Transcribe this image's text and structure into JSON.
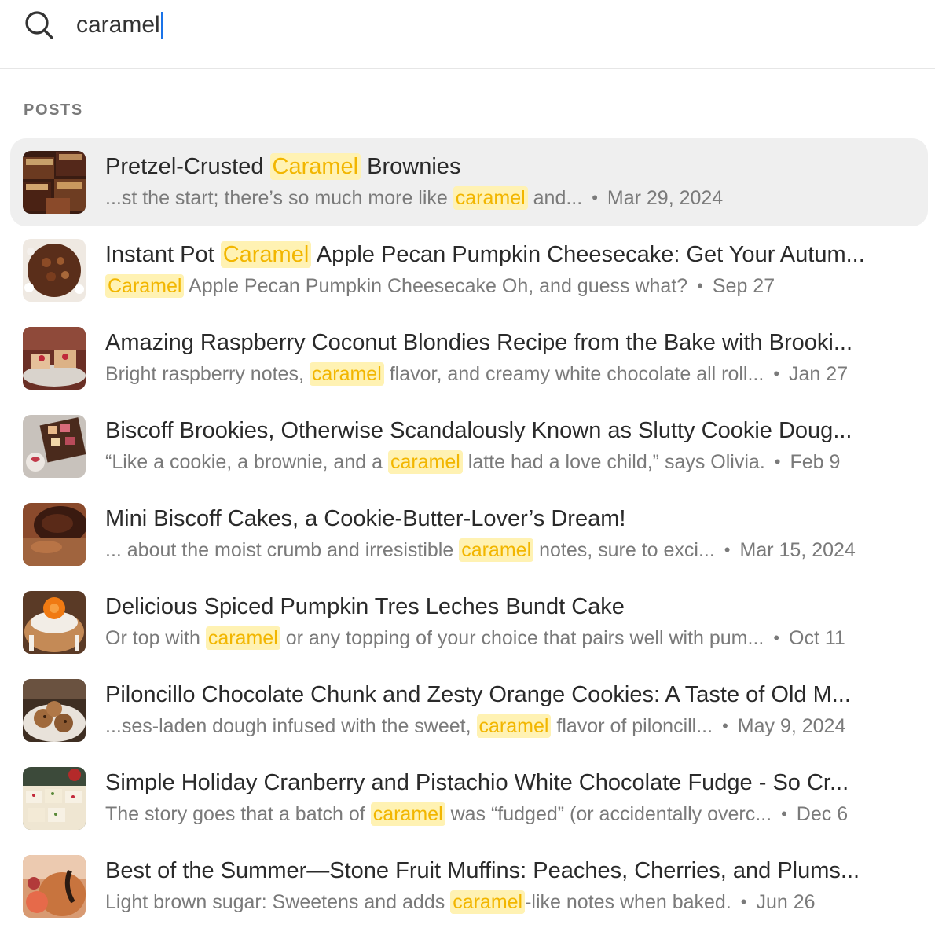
{
  "search": {
    "value": "caramel"
  },
  "section": {
    "label": "POSTS"
  },
  "colors": {
    "highlight_bg": "#fff2b3",
    "highlight_fg": "#f2b600",
    "selected_row": "#efefef",
    "caret": "#1a73e8"
  },
  "results": [
    {
      "title_pre": "Pretzel-Crusted ",
      "title_hl": "Caramel",
      "title_post": " Brownies",
      "snip_pre": "...st the start; there’s so much more like ",
      "snip_hl": "caramel",
      "snip_post": " and...",
      "date": "Mar 29, 2024"
    },
    {
      "title_pre": "Instant Pot ",
      "title_hl": "Caramel",
      "title_post": " Apple Pecan Pumpkin Cheesecake: Get Your Autum...",
      "snip_pre": "",
      "snip_hl": "Caramel",
      "snip_post": " Apple Pecan Pumpkin Cheesecake Oh, and guess what?",
      "date": "Sep 27"
    },
    {
      "title_pre": "Amazing Raspberry Coconut Blondies Recipe from the Bake with Brooki...",
      "title_hl": "",
      "title_post": "",
      "snip_pre": "Bright raspberry notes, ",
      "snip_hl": "caramel",
      "snip_post": " flavor, and creamy white chocolate all roll...",
      "date": "Jan 27"
    },
    {
      "title_pre": "Biscoff Brookies, Otherwise Scandalously Known as Slutty Cookie Doug...",
      "title_hl": "",
      "title_post": "",
      "snip_pre": "“Like a cookie, a brownie, and a ",
      "snip_hl": "caramel",
      "snip_post": " latte had a love child,” says Olivia.",
      "date": "Feb 9"
    },
    {
      "title_pre": "Mini Biscoff Cakes, a Cookie-Butter-Lover’s Dream!",
      "title_hl": "",
      "title_post": "",
      "snip_pre": "... about the moist crumb and irresistible ",
      "snip_hl": "caramel",
      "snip_post": " notes, sure to exci...",
      "date": "Mar 15, 2024"
    },
    {
      "title_pre": "Delicious Spiced Pumpkin Tres Leches Bundt Cake",
      "title_hl": "",
      "title_post": "",
      "snip_pre": "Or top with ",
      "snip_hl": "caramel",
      "snip_post": " or any topping of your choice that pairs well with pum...",
      "date": "Oct 11"
    },
    {
      "title_pre": "Piloncillo Chocolate Chunk and Zesty Orange Cookies: A Taste of Old M...",
      "title_hl": "",
      "title_post": "",
      "snip_pre": "...ses-laden dough infused with the sweet, ",
      "snip_hl": "caramel",
      "snip_post": " flavor of piloncill...",
      "date": "May 9, 2024"
    },
    {
      "title_pre": "Simple Holiday Cranberry and Pistachio White Chocolate Fudge - So Cr...",
      "title_hl": "",
      "title_post": "",
      "snip_pre": "The story goes that a batch of ",
      "snip_hl": "caramel",
      "snip_post": " was “fudged” (or accidentally overc...",
      "date": "Dec 6"
    },
    {
      "title_pre": "Best of the Summer—Stone Fruit Muffins: Peaches, Cherries, and Plums...",
      "title_hl": "",
      "title_post": "",
      "snip_pre": "Light brown sugar: Sweetens and adds ",
      "snip_hl": "caramel",
      "snip_post": "-like notes when baked.",
      "date": "Jun 26"
    }
  ]
}
